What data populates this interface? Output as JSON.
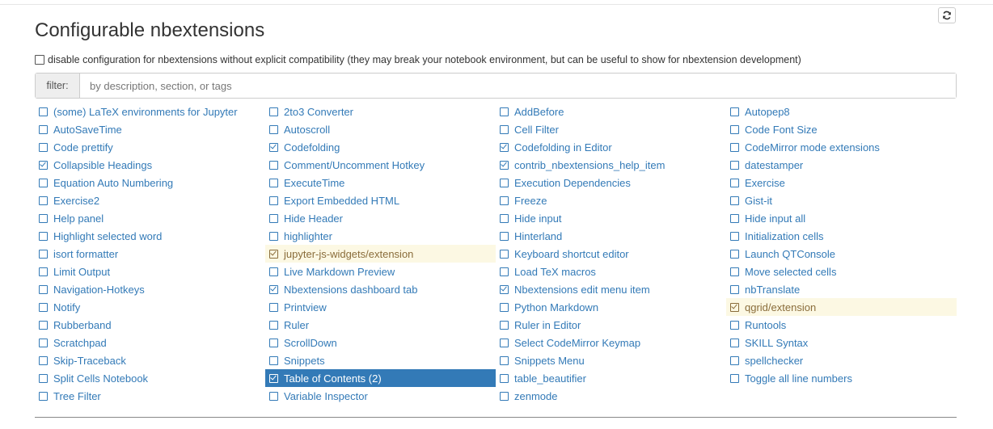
{
  "page": {
    "title": "Configurable nbextensions",
    "compat_label": "disable configuration for nbextensions without explicit compatibility (they may break your notebook environment, but can be useful to show for nbextension development)",
    "filter_label": "filter:",
    "filter_placeholder": "by description, section, or tags",
    "refresh_icon": "refresh-icon"
  },
  "colors": {
    "link": "#337ab7",
    "warning_bg": "#fcf8e3",
    "warning_text": "#8a6d3b",
    "selected_bg": "#337ab7"
  },
  "columns": [
    [
      {
        "label": "(some) LaTeX environments for Jupyter",
        "checked": false
      },
      {
        "label": "AutoSaveTime",
        "checked": false
      },
      {
        "label": "Code prettify",
        "checked": false
      },
      {
        "label": "Collapsible Headings",
        "checked": true
      },
      {
        "label": "Equation Auto Numbering",
        "checked": false
      },
      {
        "label": "Exercise2",
        "checked": false
      },
      {
        "label": "Help panel",
        "checked": false
      },
      {
        "label": "Highlight selected word",
        "checked": false
      },
      {
        "label": "isort formatter",
        "checked": false
      },
      {
        "label": "Limit Output",
        "checked": false
      },
      {
        "label": "Navigation-Hotkeys",
        "checked": false
      },
      {
        "label": "Notify",
        "checked": false
      },
      {
        "label": "Rubberband",
        "checked": false
      },
      {
        "label": "Scratchpad",
        "checked": false
      },
      {
        "label": "Skip-Traceback",
        "checked": false
      },
      {
        "label": "Split Cells Notebook",
        "checked": false
      },
      {
        "label": "Tree Filter",
        "checked": false
      }
    ],
    [
      {
        "label": "2to3 Converter",
        "checked": false
      },
      {
        "label": "Autoscroll",
        "checked": false
      },
      {
        "label": "Codefolding",
        "checked": true
      },
      {
        "label": "Comment/Uncomment Hotkey",
        "checked": false
      },
      {
        "label": "ExecuteTime",
        "checked": false
      },
      {
        "label": "Export Embedded HTML",
        "checked": false
      },
      {
        "label": "Hide Header",
        "checked": false
      },
      {
        "label": "highlighter",
        "checked": false
      },
      {
        "label": "jupyter-js-widgets/extension",
        "checked": true,
        "state": "warn"
      },
      {
        "label": "Live Markdown Preview",
        "checked": false
      },
      {
        "label": "Nbextensions dashboard tab",
        "checked": true
      },
      {
        "label": "Printview",
        "checked": false
      },
      {
        "label": "Ruler",
        "checked": false
      },
      {
        "label": "ScrollDown",
        "checked": false
      },
      {
        "label": "Snippets",
        "checked": false
      },
      {
        "label": "Table of Contents (2)",
        "checked": true,
        "state": "sel"
      },
      {
        "label": "Variable Inspector",
        "checked": false
      }
    ],
    [
      {
        "label": "AddBefore",
        "checked": false
      },
      {
        "label": "Cell Filter",
        "checked": false
      },
      {
        "label": "Codefolding in Editor",
        "checked": true
      },
      {
        "label": "contrib_nbextensions_help_item",
        "checked": true
      },
      {
        "label": "Execution Dependencies",
        "checked": false
      },
      {
        "label": "Freeze",
        "checked": false
      },
      {
        "label": "Hide input",
        "checked": false
      },
      {
        "label": "Hinterland",
        "checked": false
      },
      {
        "label": "Keyboard shortcut editor",
        "checked": false
      },
      {
        "label": "Load TeX macros",
        "checked": false
      },
      {
        "label": "Nbextensions edit menu item",
        "checked": true
      },
      {
        "label": "Python Markdown",
        "checked": false
      },
      {
        "label": "Ruler in Editor",
        "checked": false
      },
      {
        "label": "Select CodeMirror Keymap",
        "checked": false
      },
      {
        "label": "Snippets Menu",
        "checked": false
      },
      {
        "label": "table_beautifier",
        "checked": false
      },
      {
        "label": "zenmode",
        "checked": false
      }
    ],
    [
      {
        "label": "Autopep8",
        "checked": false
      },
      {
        "label": "Code Font Size",
        "checked": false
      },
      {
        "label": "CodeMirror mode extensions",
        "checked": false
      },
      {
        "label": "datestamper",
        "checked": false
      },
      {
        "label": "Exercise",
        "checked": false
      },
      {
        "label": "Gist-it",
        "checked": false
      },
      {
        "label": "Hide input all",
        "checked": false
      },
      {
        "label": "Initialization cells",
        "checked": false
      },
      {
        "label": "Launch QTConsole",
        "checked": false
      },
      {
        "label": "Move selected cells",
        "checked": false
      },
      {
        "label": "nbTranslate",
        "checked": false
      },
      {
        "label": "qgrid/extension",
        "checked": true,
        "state": "warn"
      },
      {
        "label": "Runtools",
        "checked": false
      },
      {
        "label": "SKILL Syntax",
        "checked": false
      },
      {
        "label": "spellchecker",
        "checked": false
      },
      {
        "label": "Toggle all line numbers",
        "checked": false
      }
    ]
  ]
}
